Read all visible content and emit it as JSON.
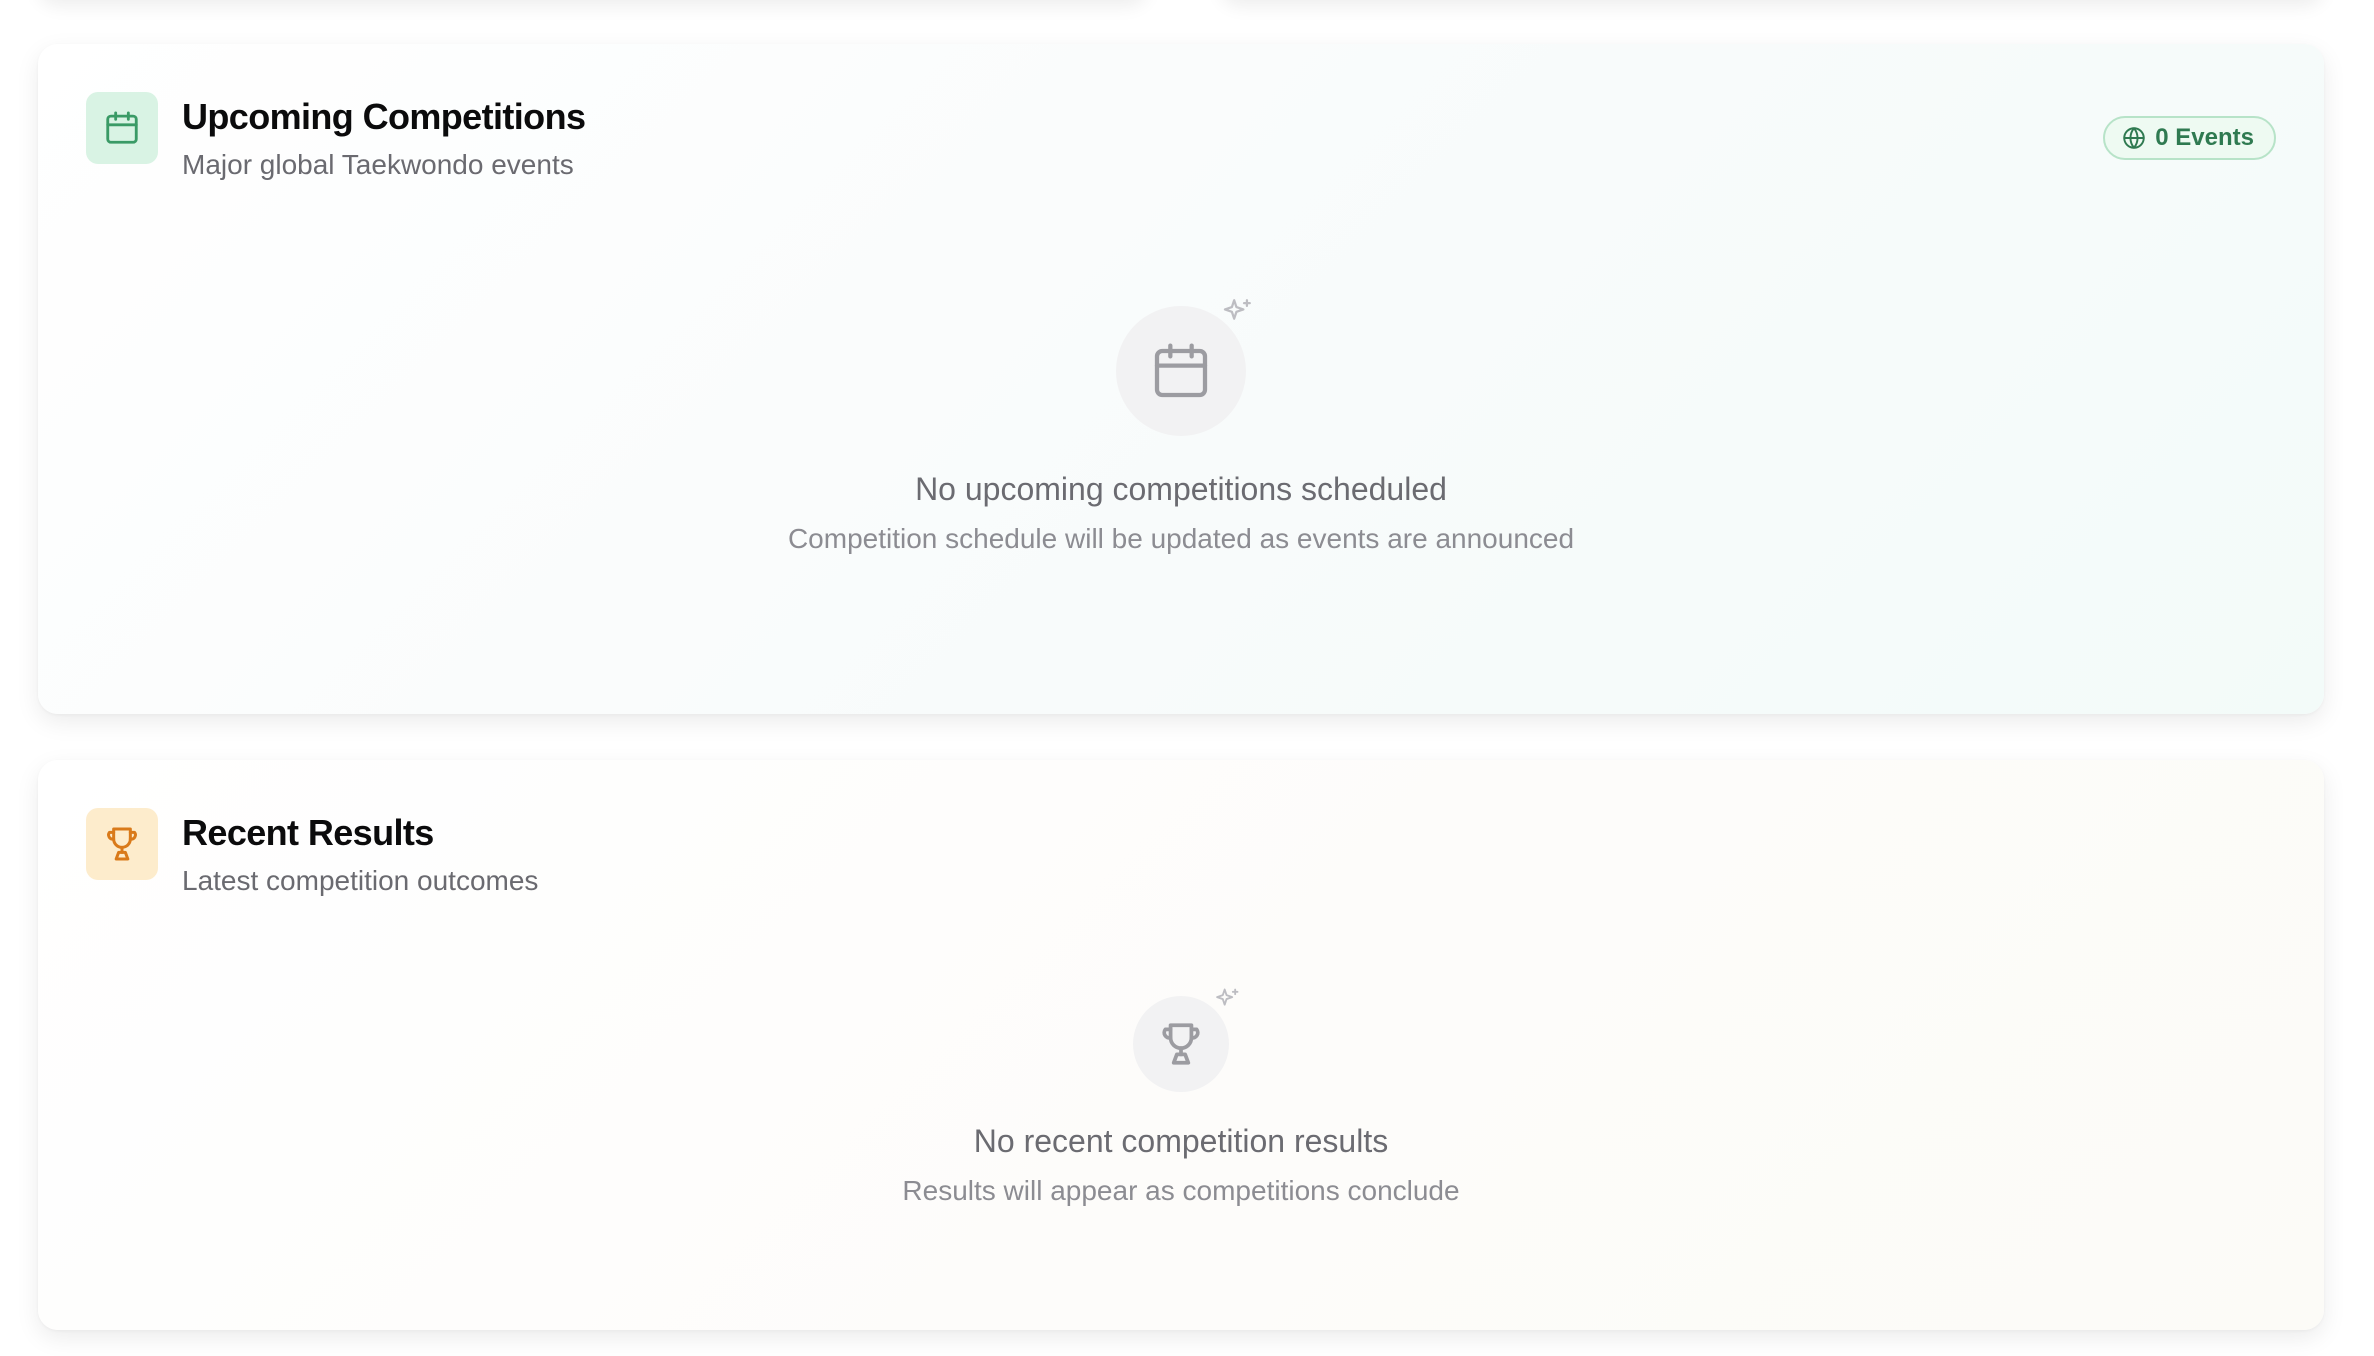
{
  "upcoming": {
    "icon": "calendar-icon",
    "title": "Upcoming Competitions",
    "subtitle": "Major global Taekwondo events",
    "badge_icon": "globe-icon",
    "badge_label": "0 Events",
    "empty_icon": "calendar-icon",
    "empty_title": "No upcoming competitions scheduled",
    "empty_desc": "Competition schedule will be updated as events are announced",
    "accent_color": "#3a9a66"
  },
  "results": {
    "icon": "trophy-icon",
    "title": "Recent Results",
    "subtitle": "Latest competition outcomes",
    "empty_icon": "trophy-icon",
    "empty_title": "No recent competition results",
    "empty_desc": "Results will appear as competitions conclude",
    "accent_color": "#d97a1a"
  }
}
